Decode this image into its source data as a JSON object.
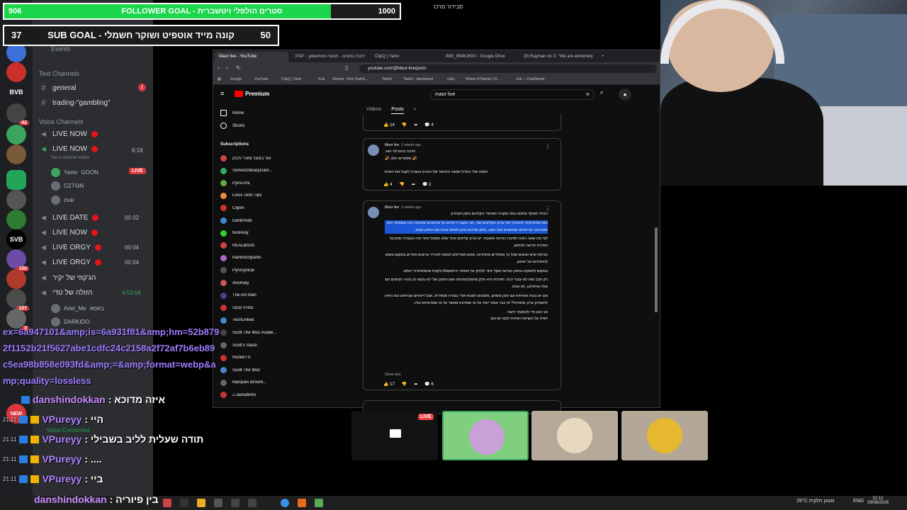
{
  "goals": {
    "follower": {
      "current": "906",
      "target": "1000",
      "label": "FOLLOWER GOAL - סטרים הולפלי ויטשברית",
      "progress": 0.906
    },
    "sub": {
      "current": "37",
      "target": "50",
      "label": "SUB GOAL - קונה מייד אוטפיט ושוקר חשמלי",
      "progress": 0.74
    }
  },
  "stream_title": "סבידור מרכז",
  "discord": {
    "events_label": "Events",
    "text_channels_label": "Text Channels",
    "text_channels": [
      {
        "name": "general",
        "mentions": "1"
      },
      {
        "name": "trading-\"gambling\""
      }
    ],
    "voice_channels_label": "Voice Channels",
    "voice_channels": [
      {
        "name": "LIVE NOW"
      },
      {
        "name": "LIVE NOW",
        "status": "Set a channel status",
        "time": "6:18"
      },
      {
        "name": "LIVE DATE",
        "count": "00 02"
      },
      {
        "name": "LIVE NOW"
      },
      {
        "name": "LIVE ORGY",
        "count": "00 04"
      },
      {
        "name": "LIVE ORGY",
        "count": "00 04"
      },
      {
        "name": "הג'קוזי של יקיר"
      },
      {
        "name": "הזולה של טדי",
        "time": "4:53:58"
      }
    ],
    "voice_users": [
      {
        "name": "Yaniv",
        "tag": "GOON",
        "live": "LIVE"
      },
      {
        "name": "ᏀᏆᎢᎾN"
      },
      {
        "name": "zvai"
      }
    ],
    "other_users": [
      {
        "name": "Ariel_Me",
        "tag": "באסא"
      },
      {
        "name": "DARKIDO"
      }
    ],
    "voice_connected": "Voice Connected",
    "server_labels": [
      "BVB",
      "SVB",
      "NEW"
    ],
    "server_badges": [
      "42",
      "100",
      "107",
      "3"
    ]
  },
  "chat": {
    "url_lines": [
      "ex=6a947101&amp;is=6a931f81&amp;hm=52b879",
      "2f1152b21f5627abe1cdfc24c2158a2f72af7b6eb89",
      "c5ea98b858e093fd&amp;=&amp;format=webp&a",
      "mp;quality=lossless"
    ],
    "messages": [
      {
        "time": "",
        "user": "danshindokkan",
        "text": ": איזה מדוכא"
      },
      {
        "time": "21:11",
        "user": "VPureyy",
        "text": ": היי"
      },
      {
        "time": "21:11",
        "user": "VPureyy",
        "text": ": תודה שעלית לליב בשבילי"
      },
      {
        "time": "21:11",
        "user": "VPureyy",
        "text": ": ...."
      },
      {
        "time": "21:11",
        "user": "VPureyy",
        "text": ": ביי"
      },
      {
        "time": "21:12",
        "user": "danshindokkan",
        "text": ": בין פיוריה"
      }
    ]
  },
  "browser": {
    "tabs": [
      "Maor live - YouTube",
      "KSP :: pokemon זמינות בזמנים - תמונה",
      "ClipQ | Yaniv",
      "IMG_0646.MOV - Google Drive",
      "(9) Rayman on X: \"We are extremely"
    ],
    "url": "youtube.com/@Maor-live/posts",
    "bookmarks": [
      "Google",
      "YouTube",
      "ClipQ | Yaniv",
      "Kick",
      "Stream - Kick Dashb...",
      "Twitch",
      "Twitch - dashboard",
      "nutty",
      "Wheel of Names | R...",
      "Edi — Dashboard"
    ],
    "yt": {
      "logo": "Premium",
      "search_value": "maor live",
      "nav": [
        "Home",
        "Shorts"
      ],
      "subscriptions_label": "Subscriptions",
      "subscriptions": [
        "אור בוטגל ומערי הכהן",
        "SomeOrdinaryGam...",
        "PyroLIVE",
        "Linus Tech Tips",
        "Clipim",
        "DankPods",
        "KickAsly",
        "REALBIGIII",
        "martinicotpants",
        "Pyrocynical",
        "Anomaly",
        "The Act Man",
        "טמויה קנקה",
        "TechLinked",
        "Scott The Woz Acade...",
        "Scott's Stash",
        "HunterTV",
        "Scott The Woz",
        "Marques Brownl...",
        "J Jackafirms"
      ],
      "tabs": [
        "Videos",
        "Posts"
      ],
      "active_tab": "Posts",
      "posts": [
        {
          "likes": "14",
          "comments": "4"
        },
        {
          "author": "Maor live",
          "ago": "2 weeks ago",
          "lines": [
            "הזיכה בהגרלה הוא:",
            "🎉 מספרים-הלב 🎉",
            "",
            "תפנה אליי במייל שמצוי בתיאור של הערוץ בשביל לקבל את הפרס"
          ],
          "likes": "4",
          "comments": "2"
        },
        {
          "author": "Maor live",
          "ago": "2 weeks ago",
          "paragraphs": [
            "רציתי לשתף אתכם במה שקורה מאחורי הקלעים בזמן האחרון.",
            "מאז שהתחלתי להפעיל את ערוץ הקליפים שלי, אני מקבל דיווחים על סרטונים שהועלו: מה שמסתר הוא שסרטונר בדיווחים שמוגשים שוב ושוב, בזמן שכרגע טוען לאחת בעיה עם התוכן עצמו.",
            "לפי מה שאני רואה הסיבה כנראה פשוטה: יש ערוץ קליפים אחר שלא מסוגל אתר את העובדה שכנכנה תחרות חדשה לתחום.",
            "כנראה שיש אנשים שכל כך מפחדים מתחרות, שהם מעדיפים לנסות להוריד ערוצים אחרים במקום פשוט להתחרות על התוכן.",
            "במקום להשקיע בתוכן כנראה שקל יותר ללחוץ על כפתור ה-Report ולקוות שהמתחרה ייעלם.",
            "רק חבל שזה לא עובד ככה. תחרות היא חלק מהפלטפורמה ואם התוכן שלי לא מוצא חן בעיני הצופים הם אלה שיחליטו, לא אתה.",
            "אם יש בעיה אמיתית עם תוכן מסוים, מוזמנים לפנות אליי בצורה מסודרת. אבל דיווחים שנראים כמו ניסיון להשתיק ערוץ מתחרה? זה כבר אומר יותר על מי שמדווח מאשר על מי שמדווחים עליו.",
            "אני כאן כדי להמשיך ליצור.",
            "תודה על הקראה ושיהיה לכם יום טוב"
          ],
          "show_less": "Show less",
          "likes": "17",
          "comments": "6"
        }
      ]
    }
  },
  "tiles": {
    "live_label": "LIVE"
  },
  "taskbar": {
    "weather": "29°C מעונן חלקית",
    "lang": "ENG",
    "time": "21:12",
    "date": "29/08/2026"
  },
  "colors": {
    "discord_bg": "#313338",
    "goal_green": "#1bd54a",
    "youtube_red": "#ff0000",
    "live_red": "#ed4245",
    "speaking_green": "#3ba55c",
    "highlight": "#1a56d6"
  }
}
